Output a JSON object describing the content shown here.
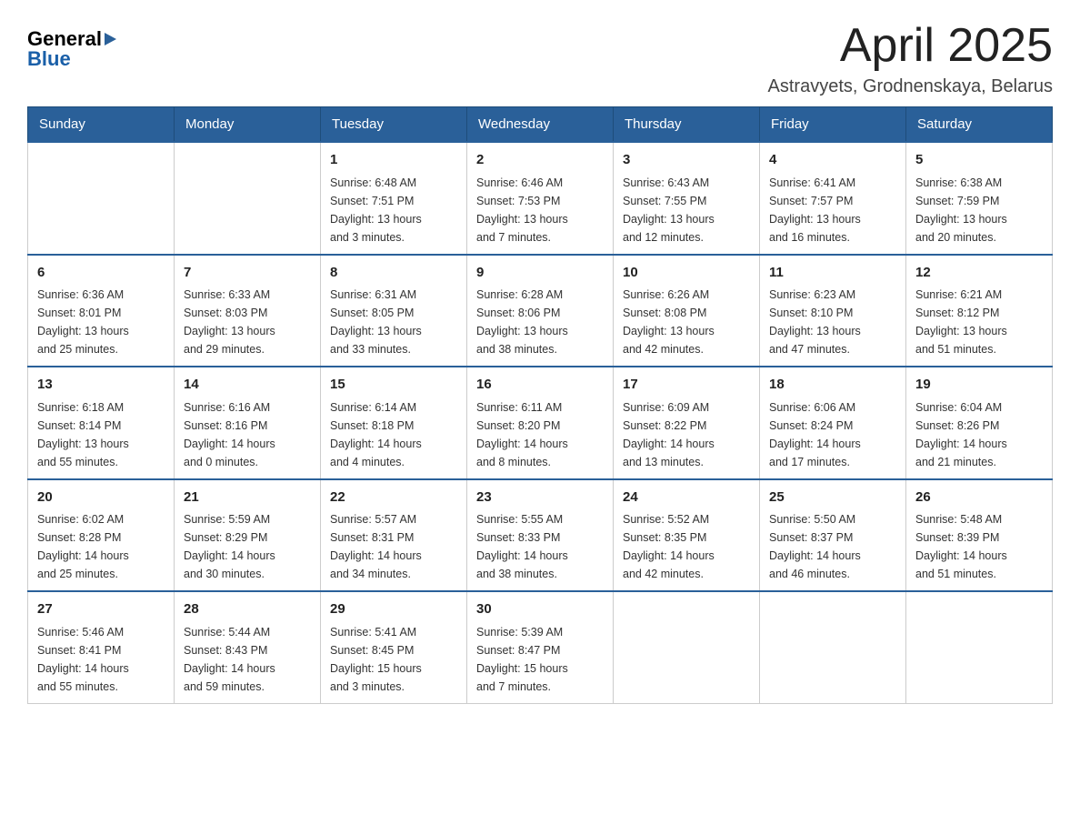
{
  "logo": {
    "text1": "General",
    "text2": "Blue"
  },
  "title": "April 2025",
  "subtitle": "Astravyets, Grodnenskaya, Belarus",
  "calendar": {
    "headers": [
      "Sunday",
      "Monday",
      "Tuesday",
      "Wednesday",
      "Thursday",
      "Friday",
      "Saturday"
    ],
    "weeks": [
      [
        {
          "day": "",
          "info": ""
        },
        {
          "day": "",
          "info": ""
        },
        {
          "day": "1",
          "info": "Sunrise: 6:48 AM\nSunset: 7:51 PM\nDaylight: 13 hours\nand 3 minutes."
        },
        {
          "day": "2",
          "info": "Sunrise: 6:46 AM\nSunset: 7:53 PM\nDaylight: 13 hours\nand 7 minutes."
        },
        {
          "day": "3",
          "info": "Sunrise: 6:43 AM\nSunset: 7:55 PM\nDaylight: 13 hours\nand 12 minutes."
        },
        {
          "day": "4",
          "info": "Sunrise: 6:41 AM\nSunset: 7:57 PM\nDaylight: 13 hours\nand 16 minutes."
        },
        {
          "day": "5",
          "info": "Sunrise: 6:38 AM\nSunset: 7:59 PM\nDaylight: 13 hours\nand 20 minutes."
        }
      ],
      [
        {
          "day": "6",
          "info": "Sunrise: 6:36 AM\nSunset: 8:01 PM\nDaylight: 13 hours\nand 25 minutes."
        },
        {
          "day": "7",
          "info": "Sunrise: 6:33 AM\nSunset: 8:03 PM\nDaylight: 13 hours\nand 29 minutes."
        },
        {
          "day": "8",
          "info": "Sunrise: 6:31 AM\nSunset: 8:05 PM\nDaylight: 13 hours\nand 33 minutes."
        },
        {
          "day": "9",
          "info": "Sunrise: 6:28 AM\nSunset: 8:06 PM\nDaylight: 13 hours\nand 38 minutes."
        },
        {
          "day": "10",
          "info": "Sunrise: 6:26 AM\nSunset: 8:08 PM\nDaylight: 13 hours\nand 42 minutes."
        },
        {
          "day": "11",
          "info": "Sunrise: 6:23 AM\nSunset: 8:10 PM\nDaylight: 13 hours\nand 47 minutes."
        },
        {
          "day": "12",
          "info": "Sunrise: 6:21 AM\nSunset: 8:12 PM\nDaylight: 13 hours\nand 51 minutes."
        }
      ],
      [
        {
          "day": "13",
          "info": "Sunrise: 6:18 AM\nSunset: 8:14 PM\nDaylight: 13 hours\nand 55 minutes."
        },
        {
          "day": "14",
          "info": "Sunrise: 6:16 AM\nSunset: 8:16 PM\nDaylight: 14 hours\nand 0 minutes."
        },
        {
          "day": "15",
          "info": "Sunrise: 6:14 AM\nSunset: 8:18 PM\nDaylight: 14 hours\nand 4 minutes."
        },
        {
          "day": "16",
          "info": "Sunrise: 6:11 AM\nSunset: 8:20 PM\nDaylight: 14 hours\nand 8 minutes."
        },
        {
          "day": "17",
          "info": "Sunrise: 6:09 AM\nSunset: 8:22 PM\nDaylight: 14 hours\nand 13 minutes."
        },
        {
          "day": "18",
          "info": "Sunrise: 6:06 AM\nSunset: 8:24 PM\nDaylight: 14 hours\nand 17 minutes."
        },
        {
          "day": "19",
          "info": "Sunrise: 6:04 AM\nSunset: 8:26 PM\nDaylight: 14 hours\nand 21 minutes."
        }
      ],
      [
        {
          "day": "20",
          "info": "Sunrise: 6:02 AM\nSunset: 8:28 PM\nDaylight: 14 hours\nand 25 minutes."
        },
        {
          "day": "21",
          "info": "Sunrise: 5:59 AM\nSunset: 8:29 PM\nDaylight: 14 hours\nand 30 minutes."
        },
        {
          "day": "22",
          "info": "Sunrise: 5:57 AM\nSunset: 8:31 PM\nDaylight: 14 hours\nand 34 minutes."
        },
        {
          "day": "23",
          "info": "Sunrise: 5:55 AM\nSunset: 8:33 PM\nDaylight: 14 hours\nand 38 minutes."
        },
        {
          "day": "24",
          "info": "Sunrise: 5:52 AM\nSunset: 8:35 PM\nDaylight: 14 hours\nand 42 minutes."
        },
        {
          "day": "25",
          "info": "Sunrise: 5:50 AM\nSunset: 8:37 PM\nDaylight: 14 hours\nand 46 minutes."
        },
        {
          "day": "26",
          "info": "Sunrise: 5:48 AM\nSunset: 8:39 PM\nDaylight: 14 hours\nand 51 minutes."
        }
      ],
      [
        {
          "day": "27",
          "info": "Sunrise: 5:46 AM\nSunset: 8:41 PM\nDaylight: 14 hours\nand 55 minutes."
        },
        {
          "day": "28",
          "info": "Sunrise: 5:44 AM\nSunset: 8:43 PM\nDaylight: 14 hours\nand 59 minutes."
        },
        {
          "day": "29",
          "info": "Sunrise: 5:41 AM\nSunset: 8:45 PM\nDaylight: 15 hours\nand 3 minutes."
        },
        {
          "day": "30",
          "info": "Sunrise: 5:39 AM\nSunset: 8:47 PM\nDaylight: 15 hours\nand 7 minutes."
        },
        {
          "day": "",
          "info": ""
        },
        {
          "day": "",
          "info": ""
        },
        {
          "day": "",
          "info": ""
        }
      ]
    ]
  }
}
